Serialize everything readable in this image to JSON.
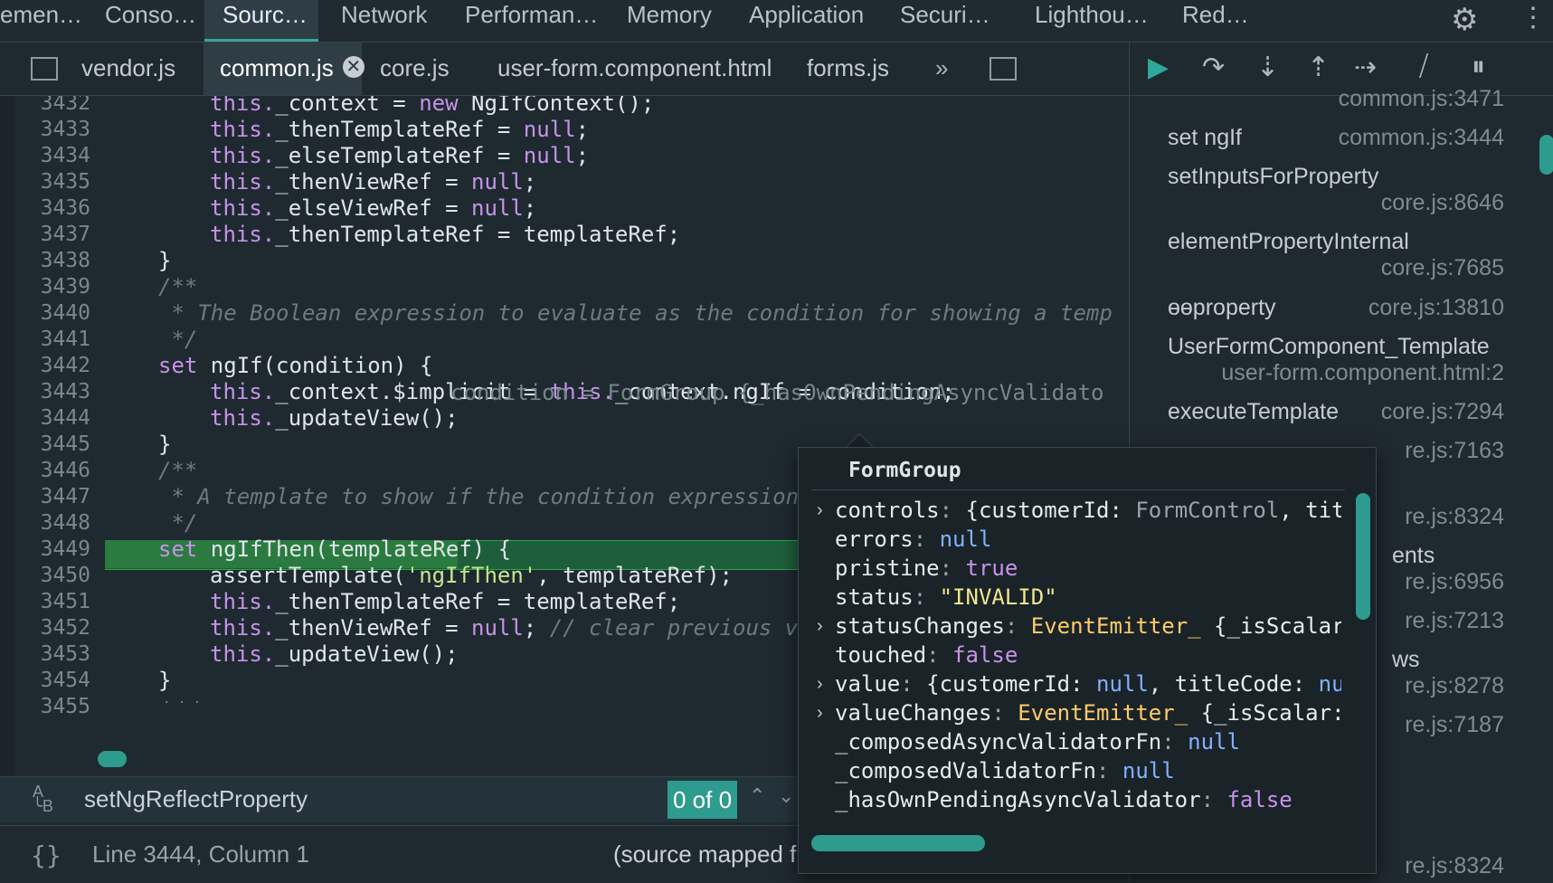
{
  "top_tabs": [
    "emen…",
    "Conso…",
    "Sourc…",
    "Network",
    "Performan…",
    "Memory",
    "Application",
    "Securi…",
    "Lighthou…",
    "Red…"
  ],
  "icons": {
    "settings": "gear-icon",
    "menu": "kebab-icon"
  },
  "file_tabs": {
    "items": [
      "vendor.js",
      "common.js",
      "core.js",
      "user-form.component.html",
      "forms.js"
    ],
    "close": "✕",
    "more": "»"
  },
  "editor": {
    "line_numbers": [
      "3432",
      "3433",
      "3434",
      "3435",
      "3436",
      "3437",
      "3438",
      "3439",
      "3440",
      "3441",
      "3442",
      "3443",
      "3444",
      "3445",
      "3446",
      "3447",
      "3448",
      "3449",
      "3450",
      "3451",
      "3452",
      "3453",
      "3454",
      "3455"
    ],
    "inline_value": "condition = FormGroup {_hasOwnPendingAsyncValidato",
    "code": {
      "l3432": {
        "a": "this.",
        "b": "_context = ",
        "c": "new ",
        "d": "NgIfContext();"
      },
      "l3433": {
        "a": "this.",
        "b": "_thenTemplateRef = ",
        "c": "null",
        "d": ";"
      },
      "l3434": {
        "a": "this.",
        "b": "_elseTemplateRef = ",
        "c": "null",
        "d": ";"
      },
      "l3435": {
        "a": "this.",
        "b": "_thenViewRef = ",
        "c": "null",
        "d": ";"
      },
      "l3436": {
        "a": "this.",
        "b": "_elseViewRef = ",
        "c": "null",
        "d": ";"
      },
      "l3437": {
        "a": "this.",
        "b": "_thenTemplateRef = templateRef;"
      },
      "l3438": "}",
      "l3439": "/**",
      "l3440": " * The Boolean expression to evaluate as the condition for showing a temp",
      "l3441": " */",
      "l3442": {
        "a": "set ",
        "b": "ngIf(condition) {"
      },
      "l3443": {
        "a": "this.",
        "b": "_context.$implicit = ",
        "c": "this.",
        "d": "_context.ngIf = ",
        "e": "condition",
        ";": ";"
      },
      "l3444": {
        "a": "this.",
        "b": "_updateView();"
      },
      "l3445": "}",
      "l3446": "/**",
      "l3447": " * A template to show if the condition expression",
      "l3448": " */",
      "l3449": {
        "a": "set ",
        "b": "ngIfThen(templateRef) {"
      },
      "l3450": {
        "a": "assertTemplate(",
        "b": "'ngIfThen'",
        "c": ", templateRef);"
      },
      "l3451": {
        "a": "this.",
        "b": "_thenTemplateRef = templateRef;"
      },
      "l3452": {
        "a": "this.",
        "b": "_thenViewRef = ",
        "c": "null",
        "d": "; ",
        "e": "// clear previous vi"
      },
      "l3453": {
        "a": "this.",
        "b": "_updateView();"
      },
      "l3454": "}",
      "l3455": "· · ·"
    }
  },
  "search": {
    "case_icon": "AₐB",
    "aa_top": "A",
    "aa_bottom": "╰B",
    "text": "setNgReflectProperty",
    "match": "0 of 0"
  },
  "status": {
    "braces": "{}",
    "position": "Line 3444, Column 1",
    "source_mapped": "(source mapped f"
  },
  "call_stack": [
    {
      "name": "",
      "loc": "common.js:3471"
    },
    {
      "name": "set ngIf",
      "loc": "common.js:3444"
    },
    {
      "name": "setInputsForProperty",
      "loc": "core.js:8646"
    },
    {
      "name": "elementPropertyInternal",
      "loc": "core.js:7685"
    },
    {
      "name": "ɵɵproperty",
      "loc": "core.js:13810"
    },
    {
      "name": "UserFormComponent_Template",
      "loc": "user-form.component.html:2"
    },
    {
      "name": "executeTemplate",
      "loc": "core.js:7294"
    },
    {
      "name": "",
      "loc": "re.js:7163"
    },
    {
      "name": "",
      "loc": "re.js:8324"
    },
    {
      "name": "ents",
      "loc": ""
    },
    {
      "name": "",
      "loc": "re.js:6956"
    },
    {
      "name": "",
      "loc": "re.js:7213"
    },
    {
      "name": "ws",
      "loc": ""
    },
    {
      "name": "",
      "loc": "re.js:8278"
    },
    {
      "name": "",
      "loc": "re.js:7187"
    },
    {
      "name": "",
      "loc": "re.js:8324"
    }
  ],
  "popover": {
    "title": "FormGroup",
    "rows": [
      {
        "key": "controls",
        "sep": ": ",
        "v1": "{customerId: ",
        "v2": "FormControl",
        "v3": ", titl"
      },
      {
        "key": "errors",
        "sep": ": ",
        "v1": "null"
      },
      {
        "key": "pristine",
        "sep": ": ",
        "v1": "true"
      },
      {
        "key": "status",
        "sep": ": ",
        "v1": "\"INVALID\""
      },
      {
        "key": "statusChanges",
        "sep": ": ",
        "v1": "EventEmitter_",
        "v2": " {_isScalar:"
      },
      {
        "key": "touched",
        "sep": ": ",
        "v1": "false"
      },
      {
        "key": "value",
        "sep": ": ",
        "v1": "{customerId: ",
        "v2": "null",
        ",": ", titleCode: ",
        "v3": "null"
      },
      {
        "key": "valueChanges",
        "sep": ": ",
        "v1": "EventEmitter_",
        "v2": " {_isScalar: "
      },
      {
        "key": "_composedAsyncValidatorFn",
        "sep": ": ",
        "v1": "null"
      },
      {
        "key": "_composedValidatorFn",
        "sep": ": ",
        "v1": "null"
      },
      {
        "key": "_hasOwnPendingAsyncValidator",
        "sep": ": ",
        "v1": "false"
      }
    ]
  }
}
